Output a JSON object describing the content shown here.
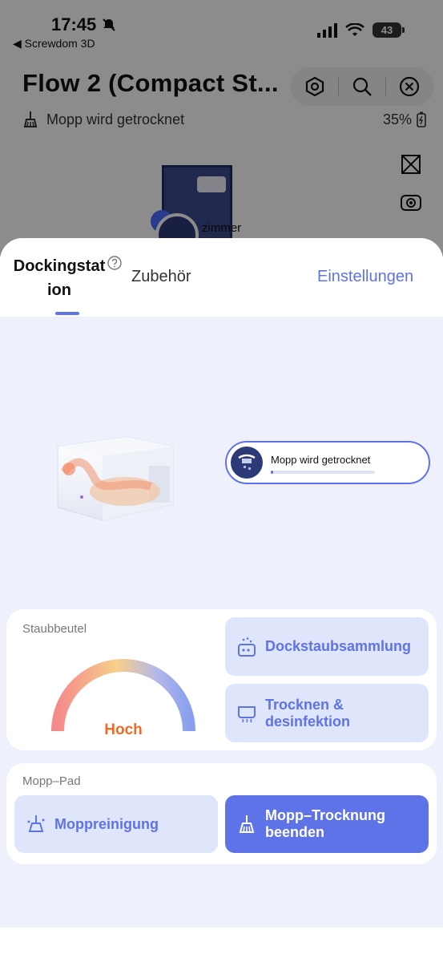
{
  "status_bar": {
    "time": "17:45",
    "back_app": "◀ Screwdom 3D",
    "battery": "43"
  },
  "header": {
    "title": "Flow 2 (Compact St...",
    "status_text": "Mopp wird getrocknet",
    "battery_percent": "35%"
  },
  "map": {
    "room_label": "zimmer"
  },
  "tabs": {
    "docking": "Dockingstation",
    "accessories": "Zubehör",
    "settings": "Einstellungen"
  },
  "station_status": {
    "text": "Mopp wird getrocknet",
    "progress": 0.02
  },
  "dust_bag": {
    "label": "Staubbeutel",
    "level": "Hoch",
    "gauge_colors": [
      "#f48a8a",
      "#f7cf8a",
      "#b4b8e8",
      "#8aa0ee"
    ]
  },
  "dock_buttons": {
    "dust_collection": "Dockstaubsammlung",
    "dry_disinfect_line1": "Trocknen &",
    "dry_disinfect_line2": "desinfektion"
  },
  "mop_pad": {
    "label": "Mopp–Pad",
    "clean": "Moppreinigung",
    "stop_dry_line1": "Mopp–Trocknung",
    "stop_dry_line2": "beenden"
  },
  "colors": {
    "accent": "#5f73e8",
    "accent_light": "#dfe5fb",
    "level_orange": "#f06a25"
  },
  "icons": {
    "settings": "hexagon-settings-icon",
    "search": "search-icon",
    "close": "close-icon",
    "mop_status": "mop-icon",
    "help": "help-icon"
  }
}
